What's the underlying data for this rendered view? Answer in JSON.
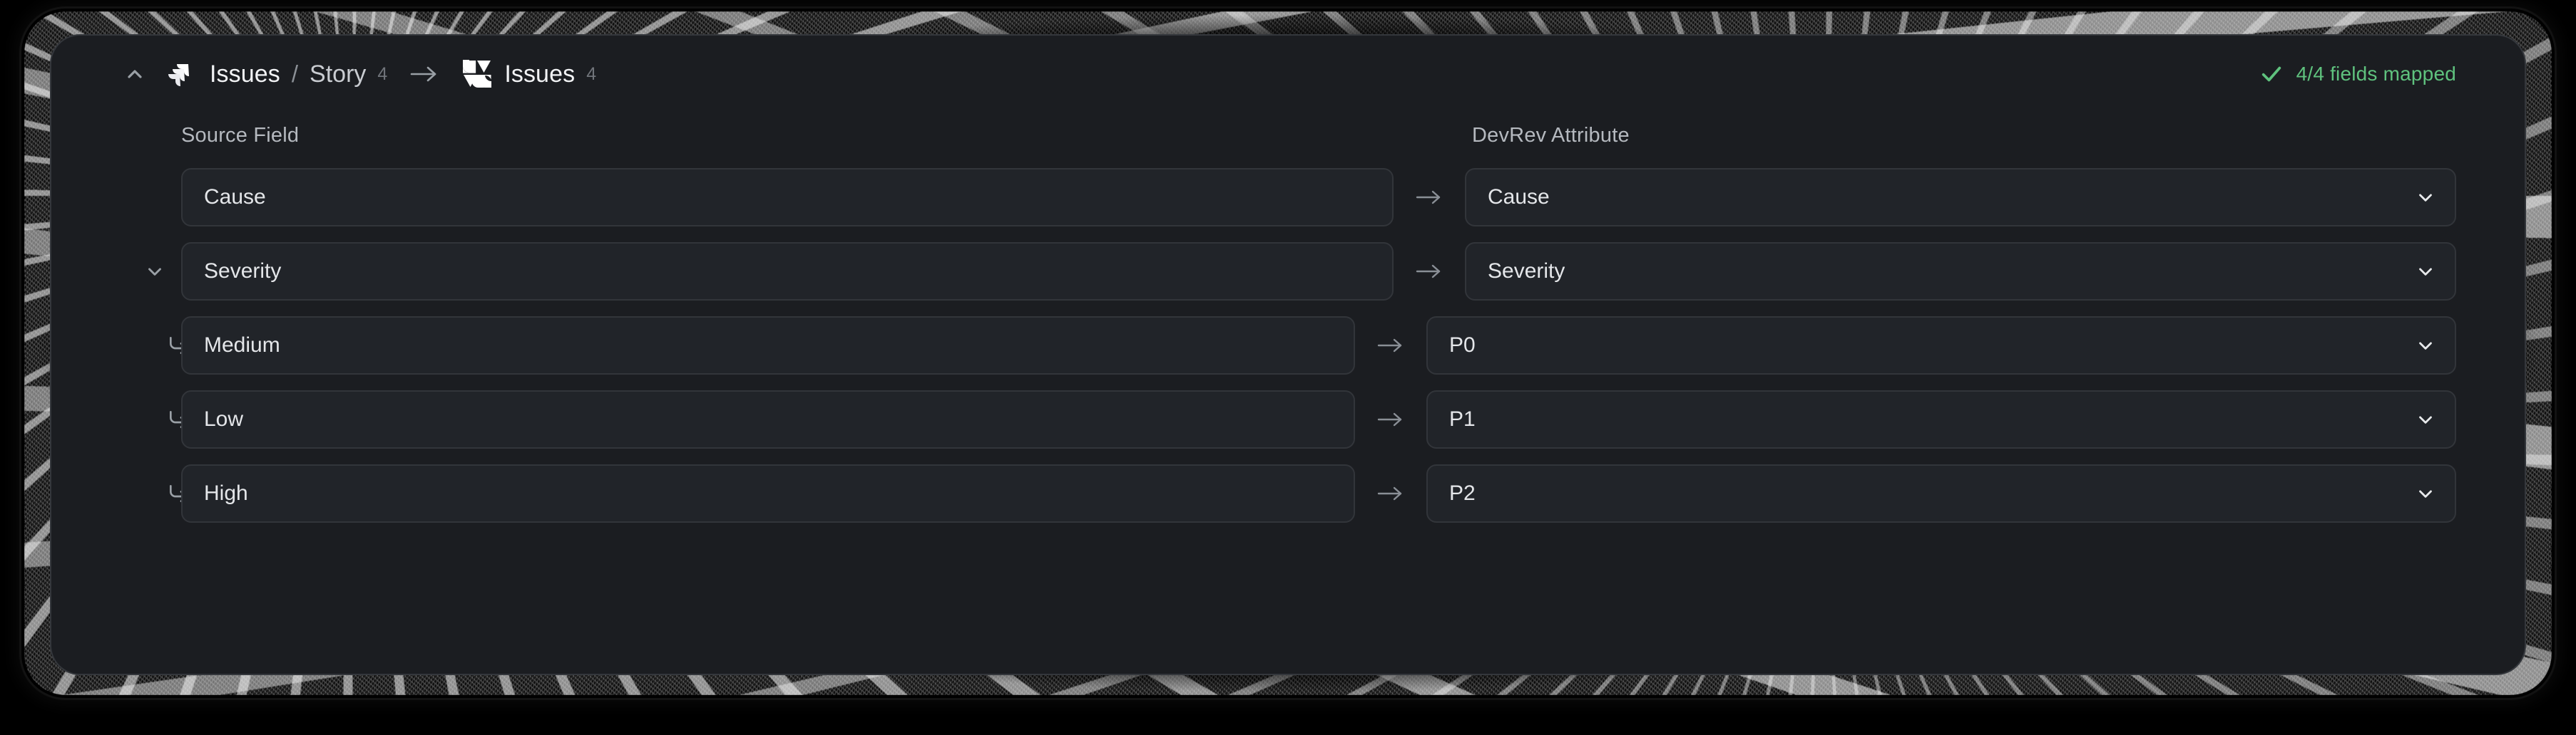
{
  "header": {
    "collapse_icon": "chevron-up-icon",
    "source": {
      "logo": "jira-icon",
      "name": "Issues",
      "separator": "/",
      "sub": "Story",
      "count": "4"
    },
    "direction_icon": "arrow-right-icon",
    "target": {
      "logo": "devrev-icon",
      "name": "Issues",
      "count": "4"
    },
    "status": {
      "icon": "check-icon",
      "text": "4/4 fields mapped",
      "color": "#5fc27e"
    }
  },
  "columns": {
    "source_label": "Source Field",
    "target_label": "DevRev Attribute"
  },
  "rows": [
    {
      "gutter_icon": "none",
      "source": "Cause",
      "arrow_icon": "arrow-right-icon",
      "target": "Cause",
      "chevron_icon": "chevron-down-icon",
      "indent": false
    },
    {
      "gutter_icon": "chevron-down-icon",
      "source": "Severity",
      "arrow_icon": "arrow-right-icon",
      "target": "Severity",
      "chevron_icon": "chevron-down-icon",
      "indent": false
    },
    {
      "gutter_icon": "corner-down-right-icon",
      "source": "Medium",
      "arrow_icon": "arrow-right-icon",
      "target": "P0",
      "chevron_icon": "chevron-down-icon",
      "indent": true
    },
    {
      "gutter_icon": "corner-down-right-icon",
      "source": "Low",
      "arrow_icon": "arrow-right-icon",
      "target": "P1",
      "chevron_icon": "chevron-down-icon",
      "indent": true
    },
    {
      "gutter_icon": "corner-down-right-icon",
      "source": "High",
      "arrow_icon": "arrow-right-icon",
      "target": "P2",
      "chevron_icon": "chevron-down-icon",
      "indent": true
    }
  ],
  "colors": {
    "page_background": "#000000",
    "card_background": "#1b1d21",
    "card_border": "#34373c",
    "field_background": "#212429",
    "field_border": "#32353a",
    "text_primary": "#e4e6e9",
    "text_secondary": "#b5b9bf",
    "text_muted": "#70747a",
    "accent_success": "#5fc27e"
  }
}
